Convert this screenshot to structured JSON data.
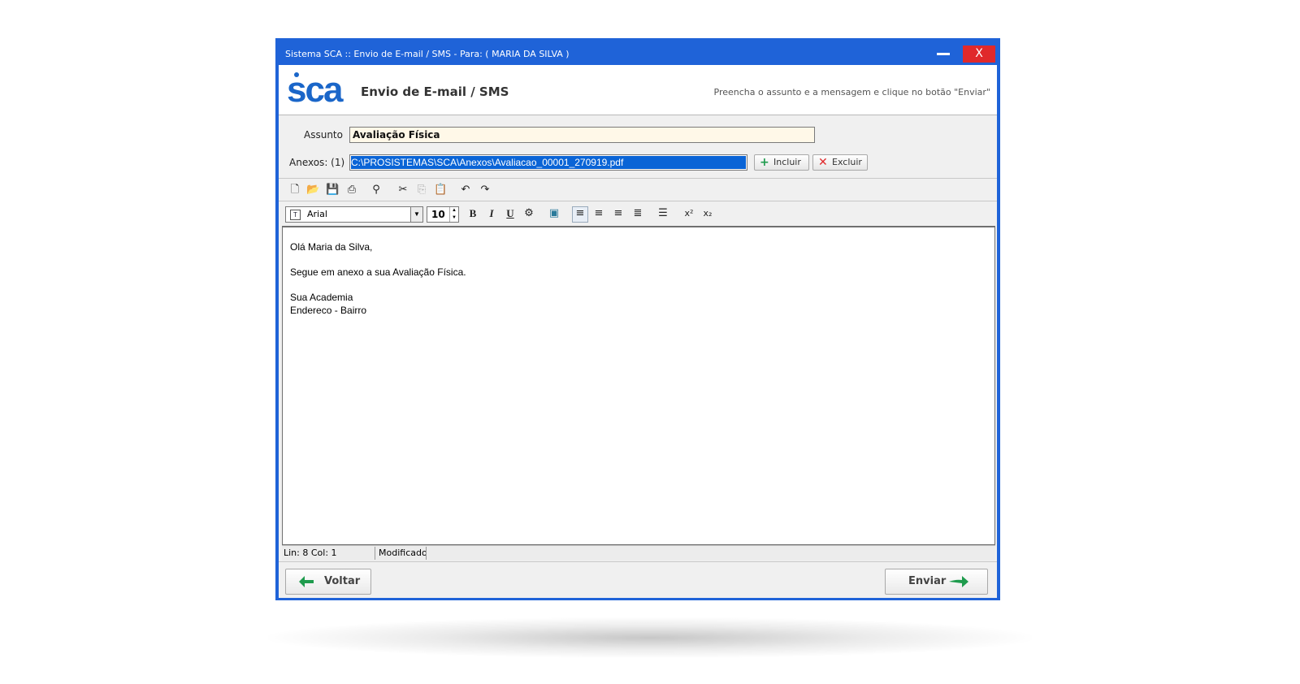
{
  "window": {
    "title": "Sistema SCA :: Envio de E-mail / SMS  -  Para: ( MARIA DA SILVA )",
    "close_label": "X"
  },
  "header": {
    "logo_text": "SCA",
    "title": "Envio de E-mail / SMS",
    "hint": "Preencha o assunto e a mensagem e clique no botão \"Enviar\""
  },
  "form": {
    "subject_label": "Assunto",
    "subject_value": "Avaliação Física",
    "attachments_label": "Anexos: (1)",
    "attachment_value": "C:\\PROSISTEMAS\\SCA\\Anexos\\Avaliacao_00001_270919.pdf",
    "add_button": "Incluir",
    "remove_button": "Excluir"
  },
  "toolbar": {
    "font_name": "Arial",
    "font_size": "10"
  },
  "editor": {
    "lines": [
      "Olá Maria da Silva,",
      "Segue em anexo a sua Avaliação Física.",
      "Sua Academia",
      "Endereco - Bairro"
    ]
  },
  "status": {
    "position": "Lin:  8  Col:  1",
    "state": "Modificado"
  },
  "footer": {
    "back_button": "Voltar",
    "send_button": "Enviar"
  },
  "colors": {
    "title_bar": "#1f63d8",
    "close_button": "#e0292b",
    "logo": "#1a66c9",
    "subject_bg": "#fff8e8",
    "selection": "#0a64d6",
    "arrow_green": "#1e9b4d"
  }
}
